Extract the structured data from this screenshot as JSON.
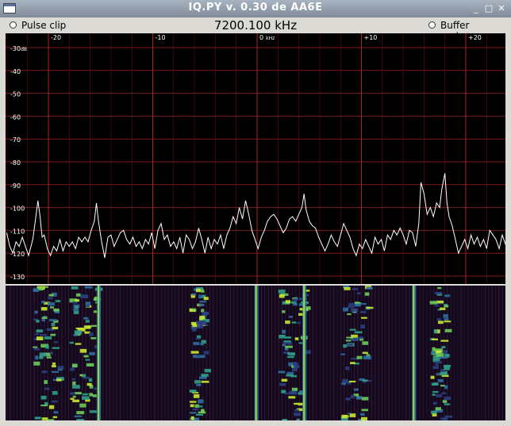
{
  "window": {
    "title": "IQ.PY v. 0.30 de AA6E",
    "min": "_",
    "max": "□",
    "close": "✕"
  },
  "toolbar": {
    "pulse_clip": "Pulse clip",
    "frequency": "7200.100 kHz",
    "buffer_underrun": "Buffer underrun"
  },
  "spectrum": {
    "db_unit": "dB",
    "db_labels": [
      "-30",
      "-40",
      "-50",
      "-60",
      "-70",
      "-80",
      "-90",
      "-100",
      "-110",
      "-120",
      "-130"
    ],
    "db_values": [
      -30,
      -40,
      -50,
      -60,
      -70,
      -80,
      -90,
      -100,
      -110,
      -120,
      -130
    ],
    "khz_labels": [
      "-20",
      "-10",
      "0",
      "+10",
      "+20"
    ],
    "khz_values": [
      -20,
      -10,
      0,
      10,
      20
    ],
    "khz_unit": "kHz",
    "trace": [
      [
        -24.0,
        -111
      ],
      [
        -23.7,
        -117
      ],
      [
        -23.4,
        -120
      ],
      [
        -23.1,
        -115
      ],
      [
        -22.8,
        -117
      ],
      [
        -22.5,
        -113
      ],
      [
        -22.2,
        -117
      ],
      [
        -21.9,
        -121
      ],
      [
        -21.5,
        -114
      ],
      [
        -21.2,
        -104
      ],
      [
        -21.0,
        -97
      ],
      [
        -20.8,
        -104
      ],
      [
        -20.6,
        -113
      ],
      [
        -20.4,
        -112
      ],
      [
        -20.1,
        -118
      ],
      [
        -19.8,
        -121
      ],
      [
        -19.5,
        -117
      ],
      [
        -19.2,
        -119
      ],
      [
        -18.9,
        -114
      ],
      [
        -18.6,
        -119
      ],
      [
        -18.3,
        -115
      ],
      [
        -18.0,
        -117
      ],
      [
        -17.7,
        -115
      ],
      [
        -17.4,
        -118
      ],
      [
        -17.1,
        -113
      ],
      [
        -16.8,
        -115
      ],
      [
        -16.5,
        -113
      ],
      [
        -16.2,
        -115
      ],
      [
        -15.9,
        -110
      ],
      [
        -15.6,
        -106
      ],
      [
        -15.4,
        -98
      ],
      [
        -15.2,
        -106
      ],
      [
        -14.9,
        -115
      ],
      [
        -14.6,
        -122
      ],
      [
        -14.3,
        -113
      ],
      [
        -14.0,
        -112
      ],
      [
        -13.7,
        -117
      ],
      [
        -13.4,
        -114
      ],
      [
        -13.1,
        -111
      ],
      [
        -12.8,
        -110
      ],
      [
        -12.5,
        -114
      ],
      [
        -12.2,
        -116
      ],
      [
        -11.9,
        -113
      ],
      [
        -11.6,
        -117
      ],
      [
        -11.3,
        -115
      ],
      [
        -11.0,
        -118
      ],
      [
        -10.7,
        -114
      ],
      [
        -10.4,
        -116
      ],
      [
        -10.1,
        -111
      ],
      [
        -9.8,
        -118
      ],
      [
        -9.5,
        -110
      ],
      [
        -9.2,
        -107
      ],
      [
        -8.9,
        -114
      ],
      [
        -8.6,
        -112
      ],
      [
        -8.3,
        -117
      ],
      [
        -8.0,
        -115
      ],
      [
        -7.7,
        -118
      ],
      [
        -7.4,
        -113
      ],
      [
        -7.1,
        -120
      ],
      [
        -6.8,
        -112
      ],
      [
        -6.5,
        -114
      ],
      [
        -6.2,
        -118
      ],
      [
        -5.9,
        -115
      ],
      [
        -5.6,
        -109
      ],
      [
        -5.3,
        -114
      ],
      [
        -5.0,
        -120
      ],
      [
        -4.7,
        -113
      ],
      [
        -4.4,
        -118
      ],
      [
        -4.1,
        -114
      ],
      [
        -3.8,
        -116
      ],
      [
        -3.5,
        -112
      ],
      [
        -3.2,
        -118
      ],
      [
        -2.9,
        -112
      ],
      [
        -2.6,
        -109
      ],
      [
        -2.3,
        -104
      ],
      [
        -2.0,
        -107
      ],
      [
        -1.7,
        -100
      ],
      [
        -1.4,
        -105
      ],
      [
        -1.1,
        -97
      ],
      [
        -0.8,
        -103
      ],
      [
        -0.5,
        -110
      ],
      [
        -0.2,
        -114
      ],
      [
        0.1,
        -118
      ],
      [
        0.4,
        -113
      ],
      [
        0.7,
        -110
      ],
      [
        1.0,
        -106
      ],
      [
        1.3,
        -104
      ],
      [
        1.6,
        -103
      ],
      [
        1.9,
        -105
      ],
      [
        2.2,
        -108
      ],
      [
        2.5,
        -111
      ],
      [
        2.8,
        -109
      ],
      [
        3.1,
        -105
      ],
      [
        3.4,
        -104
      ],
      [
        3.7,
        -106
      ],
      [
        4.0,
        -103
      ],
      [
        4.3,
        -100
      ],
      [
        4.5,
        -94
      ],
      [
        4.7,
        -101
      ],
      [
        5.0,
        -106
      ],
      [
        5.3,
        -108
      ],
      [
        5.6,
        -109
      ],
      [
        5.9,
        -113
      ],
      [
        6.2,
        -116
      ],
      [
        6.5,
        -119
      ],
      [
        6.8,
        -116
      ],
      [
        7.1,
        -112
      ],
      [
        7.4,
        -115
      ],
      [
        7.7,
        -117
      ],
      [
        8.0,
        -112
      ],
      [
        8.3,
        -107
      ],
      [
        8.6,
        -110
      ],
      [
        8.9,
        -113
      ],
      [
        9.2,
        -118
      ],
      [
        9.5,
        -121
      ],
      [
        9.8,
        -116
      ],
      [
        10.1,
        -118
      ],
      [
        10.4,
        -114
      ],
      [
        10.7,
        -117
      ],
      [
        11.0,
        -120
      ],
      [
        11.3,
        -113
      ],
      [
        11.6,
        -116
      ],
      [
        11.9,
        -114
      ],
      [
        12.2,
        -119
      ],
      [
        12.5,
        -112
      ],
      [
        12.8,
        -114
      ],
      [
        13.1,
        -110
      ],
      [
        13.4,
        -112
      ],
      [
        13.7,
        -109
      ],
      [
        14.0,
        -112
      ],
      [
        14.3,
        -116
      ],
      [
        14.6,
        -110
      ],
      [
        14.9,
        -111
      ],
      [
        15.2,
        -117
      ],
      [
        15.5,
        -107
      ],
      [
        15.7,
        -89
      ],
      [
        16.0,
        -94
      ],
      [
        16.3,
        -103
      ],
      [
        16.6,
        -100
      ],
      [
        16.9,
        -104
      ],
      [
        17.2,
        -98
      ],
      [
        17.5,
        -100
      ],
      [
        17.7,
        -92
      ],
      [
        18.0,
        -85
      ],
      [
        18.2,
        -98
      ],
      [
        18.4,
        -104
      ],
      [
        18.7,
        -108
      ],
      [
        19.0,
        -114
      ],
      [
        19.3,
        -120
      ],
      [
        19.6,
        -117
      ],
      [
        19.9,
        -114
      ],
      [
        20.2,
        -118
      ],
      [
        20.5,
        -112
      ],
      [
        20.8,
        -116
      ],
      [
        21.1,
        -113
      ],
      [
        21.4,
        -117
      ],
      [
        21.7,
        -114
      ],
      [
        22.0,
        -118
      ],
      [
        22.3,
        -110
      ],
      [
        22.6,
        -112
      ],
      [
        22.9,
        -114
      ],
      [
        23.2,
        -118
      ],
      [
        23.5,
        -112
      ],
      [
        23.8,
        -116
      ],
      [
        24.1,
        -110
      ],
      [
        24.4,
        -113
      ],
      [
        24.7,
        -115
      ],
      [
        24.9,
        -118
      ]
    ]
  },
  "waterfall": {
    "strong_lines_khz": [
      -15.2,
      -0.1,
      4.5,
      15.0
    ],
    "clusters_khz": [
      [
        -21.5,
        -19.0
      ],
      [
        -18.0,
        -15.5
      ],
      [
        -6.5,
        -5.0
      ],
      [
        2.0,
        4.5
      ],
      [
        8.0,
        10.5
      ],
      [
        16.5,
        18.0
      ]
    ]
  }
}
